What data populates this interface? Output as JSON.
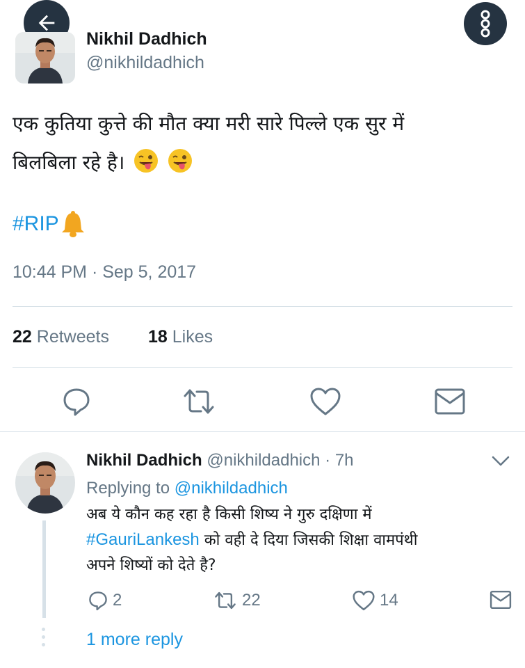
{
  "tweet": {
    "author_name": "Nikhil Dadhich",
    "author_handle": "@nikhildadhich",
    "text_line1": "एक कुतिया कुत्ते की मौत क्या मरी सारे पिल्ले एक सुर में",
    "text_line2": "बिलबिला रहे है।",
    "hashtag": "#RIP",
    "timestamp": "10:44 PM · Sep 5, 2017",
    "retweets_count": "22",
    "retweets_label": "Retweets",
    "likes_count": "18",
    "likes_label": "Likes"
  },
  "actions": [
    "reply-icon",
    "retweet-icon",
    "like-icon",
    "message-icon"
  ],
  "reply": {
    "author_name": "Nikhil Dadhich",
    "author_handle": "@nikhildadhich",
    "time_ago": "· 7h",
    "replying_prefix": "Replying to",
    "replying_to": "@nikhildadhich",
    "text_line1": "अब ये कौन कह रहा है किसी शिष्य ने गुरु दक्षिणा में",
    "text_hashtag": "#GauriLankesh",
    "text_line2_rest": " को वही दे दिया जिसकी शिक्षा वामपंथी",
    "text_line3": "अपने शिष्यों को देते है?",
    "reply_count": "2",
    "retweet_count": "22",
    "like_count": "14"
  },
  "more_replies": "1 more reply",
  "colors": {
    "accent": "#1b95e0",
    "secondary_text": "#657786",
    "primary_text": "#14171a",
    "divider": "#d7e1e8",
    "overlay_button": "#253341"
  }
}
